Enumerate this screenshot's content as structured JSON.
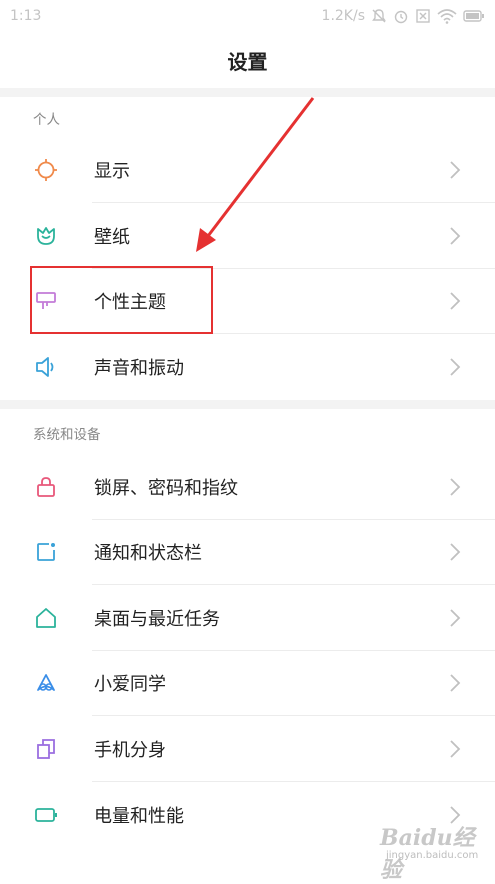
{
  "status_bar": {
    "time": "1:13",
    "network_speed": "1.2K/s",
    "icons": [
      "mute-icon",
      "alarm-icon",
      "signal-x-icon",
      "wifi-icon",
      "battery-icon"
    ]
  },
  "title": "设置",
  "sections": [
    {
      "header": "个人",
      "items": [
        {
          "label": "显示",
          "icon": "sun-icon",
          "color": "#f08a4b"
        },
        {
          "label": "壁纸",
          "icon": "tulip-icon",
          "color": "#2bb39b"
        },
        {
          "label": "个性主题",
          "icon": "brush-icon",
          "color": "#c37bd8"
        },
        {
          "label": "声音和振动",
          "icon": "speaker-icon",
          "color": "#3aa2d8"
        }
      ]
    },
    {
      "header": "系统和设备",
      "items": [
        {
          "label": "锁屏、密码和指纹",
          "icon": "lock-icon",
          "color": "#e8577a"
        },
        {
          "label": "通知和状态栏",
          "icon": "notification-icon",
          "color": "#3aa2d8"
        },
        {
          "label": "桌面与最近任务",
          "icon": "home-icon",
          "color": "#2bb39b"
        },
        {
          "label": "小爱同学",
          "icon": "xiaoai-icon",
          "color": "#3a8ee8"
        },
        {
          "label": "手机分身",
          "icon": "second-space-icon",
          "color": "#9b6fe0"
        },
        {
          "label": "电量和性能",
          "icon": "battery-icon",
          "color": "#2bb39b"
        }
      ]
    }
  ],
  "watermark": {
    "main": "Baidu经验",
    "sub": "jingyan.baidu.com"
  },
  "annotation_color": "#e53131"
}
